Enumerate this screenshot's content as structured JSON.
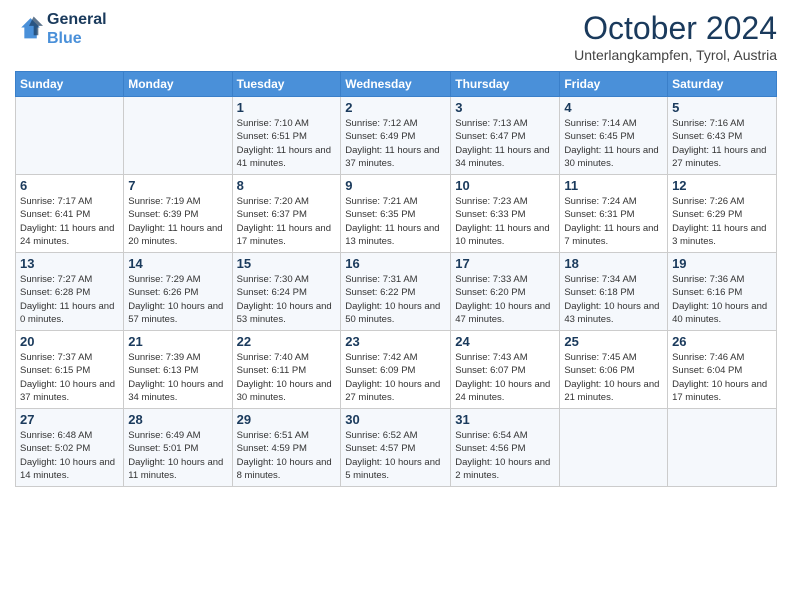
{
  "header": {
    "logo_line1": "General",
    "logo_line2": "Blue",
    "month_title": "October 2024",
    "subtitle": "Unterlangkampfen, Tyrol, Austria"
  },
  "days_of_week": [
    "Sunday",
    "Monday",
    "Tuesday",
    "Wednesday",
    "Thursday",
    "Friday",
    "Saturday"
  ],
  "weeks": [
    [
      {
        "day": "",
        "info": ""
      },
      {
        "day": "",
        "info": ""
      },
      {
        "day": "1",
        "info": "Sunrise: 7:10 AM\nSunset: 6:51 PM\nDaylight: 11 hours and 41 minutes."
      },
      {
        "day": "2",
        "info": "Sunrise: 7:12 AM\nSunset: 6:49 PM\nDaylight: 11 hours and 37 minutes."
      },
      {
        "day": "3",
        "info": "Sunrise: 7:13 AM\nSunset: 6:47 PM\nDaylight: 11 hours and 34 minutes."
      },
      {
        "day": "4",
        "info": "Sunrise: 7:14 AM\nSunset: 6:45 PM\nDaylight: 11 hours and 30 minutes."
      },
      {
        "day": "5",
        "info": "Sunrise: 7:16 AM\nSunset: 6:43 PM\nDaylight: 11 hours and 27 minutes."
      }
    ],
    [
      {
        "day": "6",
        "info": "Sunrise: 7:17 AM\nSunset: 6:41 PM\nDaylight: 11 hours and 24 minutes."
      },
      {
        "day": "7",
        "info": "Sunrise: 7:19 AM\nSunset: 6:39 PM\nDaylight: 11 hours and 20 minutes."
      },
      {
        "day": "8",
        "info": "Sunrise: 7:20 AM\nSunset: 6:37 PM\nDaylight: 11 hours and 17 minutes."
      },
      {
        "day": "9",
        "info": "Sunrise: 7:21 AM\nSunset: 6:35 PM\nDaylight: 11 hours and 13 minutes."
      },
      {
        "day": "10",
        "info": "Sunrise: 7:23 AM\nSunset: 6:33 PM\nDaylight: 11 hours and 10 minutes."
      },
      {
        "day": "11",
        "info": "Sunrise: 7:24 AM\nSunset: 6:31 PM\nDaylight: 11 hours and 7 minutes."
      },
      {
        "day": "12",
        "info": "Sunrise: 7:26 AM\nSunset: 6:29 PM\nDaylight: 11 hours and 3 minutes."
      }
    ],
    [
      {
        "day": "13",
        "info": "Sunrise: 7:27 AM\nSunset: 6:28 PM\nDaylight: 11 hours and 0 minutes."
      },
      {
        "day": "14",
        "info": "Sunrise: 7:29 AM\nSunset: 6:26 PM\nDaylight: 10 hours and 57 minutes."
      },
      {
        "day": "15",
        "info": "Sunrise: 7:30 AM\nSunset: 6:24 PM\nDaylight: 10 hours and 53 minutes."
      },
      {
        "day": "16",
        "info": "Sunrise: 7:31 AM\nSunset: 6:22 PM\nDaylight: 10 hours and 50 minutes."
      },
      {
        "day": "17",
        "info": "Sunrise: 7:33 AM\nSunset: 6:20 PM\nDaylight: 10 hours and 47 minutes."
      },
      {
        "day": "18",
        "info": "Sunrise: 7:34 AM\nSunset: 6:18 PM\nDaylight: 10 hours and 43 minutes."
      },
      {
        "day": "19",
        "info": "Sunrise: 7:36 AM\nSunset: 6:16 PM\nDaylight: 10 hours and 40 minutes."
      }
    ],
    [
      {
        "day": "20",
        "info": "Sunrise: 7:37 AM\nSunset: 6:15 PM\nDaylight: 10 hours and 37 minutes."
      },
      {
        "day": "21",
        "info": "Sunrise: 7:39 AM\nSunset: 6:13 PM\nDaylight: 10 hours and 34 minutes."
      },
      {
        "day": "22",
        "info": "Sunrise: 7:40 AM\nSunset: 6:11 PM\nDaylight: 10 hours and 30 minutes."
      },
      {
        "day": "23",
        "info": "Sunrise: 7:42 AM\nSunset: 6:09 PM\nDaylight: 10 hours and 27 minutes."
      },
      {
        "day": "24",
        "info": "Sunrise: 7:43 AM\nSunset: 6:07 PM\nDaylight: 10 hours and 24 minutes."
      },
      {
        "day": "25",
        "info": "Sunrise: 7:45 AM\nSunset: 6:06 PM\nDaylight: 10 hours and 21 minutes."
      },
      {
        "day": "26",
        "info": "Sunrise: 7:46 AM\nSunset: 6:04 PM\nDaylight: 10 hours and 17 minutes."
      }
    ],
    [
      {
        "day": "27",
        "info": "Sunrise: 6:48 AM\nSunset: 5:02 PM\nDaylight: 10 hours and 14 minutes."
      },
      {
        "day": "28",
        "info": "Sunrise: 6:49 AM\nSunset: 5:01 PM\nDaylight: 10 hours and 11 minutes."
      },
      {
        "day": "29",
        "info": "Sunrise: 6:51 AM\nSunset: 4:59 PM\nDaylight: 10 hours and 8 minutes."
      },
      {
        "day": "30",
        "info": "Sunrise: 6:52 AM\nSunset: 4:57 PM\nDaylight: 10 hours and 5 minutes."
      },
      {
        "day": "31",
        "info": "Sunrise: 6:54 AM\nSunset: 4:56 PM\nDaylight: 10 hours and 2 minutes."
      },
      {
        "day": "",
        "info": ""
      },
      {
        "day": "",
        "info": ""
      }
    ]
  ]
}
